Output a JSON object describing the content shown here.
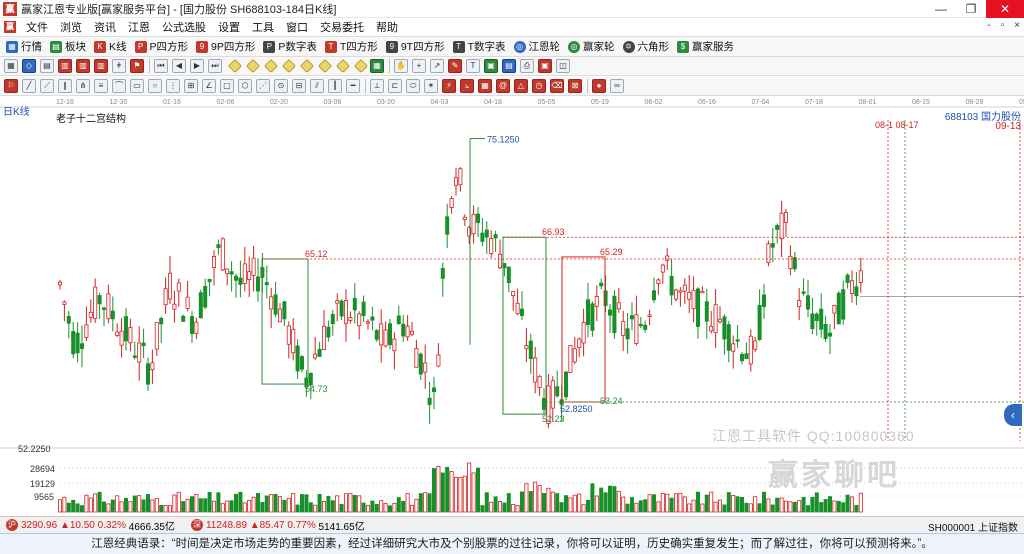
{
  "window": {
    "title": "赢家江恩专业版[赢家服务平台] - [国力股份  SH688103-184日K线]"
  },
  "menu": {
    "items": [
      "文件",
      "浏览",
      "资讯",
      "江恩",
      "公式选股",
      "设置",
      "工具",
      "窗口",
      "交易委托",
      "帮助"
    ],
    "right_controls": [
      "-",
      "▫",
      "×"
    ]
  },
  "toolbar1": {
    "items": [
      {
        "label": "行情",
        "color": "#2d6ac0"
      },
      {
        "label": "板块",
        "color": "#2e8b3d"
      },
      {
        "label": "K线",
        "color": "#c0392b"
      },
      {
        "label": "P四方形",
        "color": "#c0392b"
      },
      {
        "label": "9P四方形",
        "color": "#c0392b"
      },
      {
        "label": "P数字表",
        "color": "#444444"
      },
      {
        "label": "T四方形",
        "color": "#c0392b"
      },
      {
        "label": "9T四方形",
        "color": "#444444"
      },
      {
        "label": "T数字表",
        "color": "#444444"
      },
      {
        "label": "江恩轮",
        "color": "#2d6ac0"
      },
      {
        "label": "赢家轮",
        "color": "#2e8b3d"
      },
      {
        "label": "六角形",
        "color": "#444444"
      },
      {
        "label": "赢家服务",
        "color": "#2e8b3d"
      }
    ]
  },
  "chart": {
    "ktype_label": "日K线",
    "indicator_label": "老子十二宫结构",
    "stock_label": "688103 国力股份",
    "right_date": "09-13",
    "vline_dates": "08-1 08-17",
    "date_ticks": [
      "12-16",
      "12-30",
      "01-16",
      "02-06",
      "02-20",
      "03-06",
      "03-20",
      "04-03",
      "04-18",
      "05-05",
      "05-19",
      "06-02",
      "06-16",
      "07-04",
      "07-18",
      "08-01",
      "08-15",
      "08-29",
      "09-12"
    ],
    "price_labels": {
      "p1": "75.1250",
      "p2": "65.12",
      "p3": "66.93",
      "p4": "65.29",
      "p5": "54.73",
      "p6": "52.23",
      "p7": "52.8250",
      "p8": "53.24"
    },
    "axis_labels": {
      "y52": "52.2250",
      "v1": "28694",
      "v2": "19129",
      "v3": "9565"
    }
  },
  "watermark": {
    "line1": "江恩工具软件  QQ:100800360",
    "line2": "赢家聊吧"
  },
  "status": {
    "sh_index": "3290.96",
    "sh_change": "▲10.50",
    "sh_pct": "0.32%",
    "sh_amount": "4666.35亿",
    "sz_index": "11248.89",
    "sz_change": "▲85.47",
    "sz_pct": "0.77%",
    "sz_amount": "5141.65亿",
    "right_label": "SH000001 上证指数"
  },
  "quote": {
    "text": "江恩经典语录：“时间是决定市场走势的重要因素，经过详细研究大市及个别股票的过往记录，你将可以证明，历史确实重复发生；而了解过往，你将可以预测将来。”。"
  },
  "colors": {
    "up": "#d62020",
    "down": "#18902a",
    "line": "#1c4fb0"
  }
}
